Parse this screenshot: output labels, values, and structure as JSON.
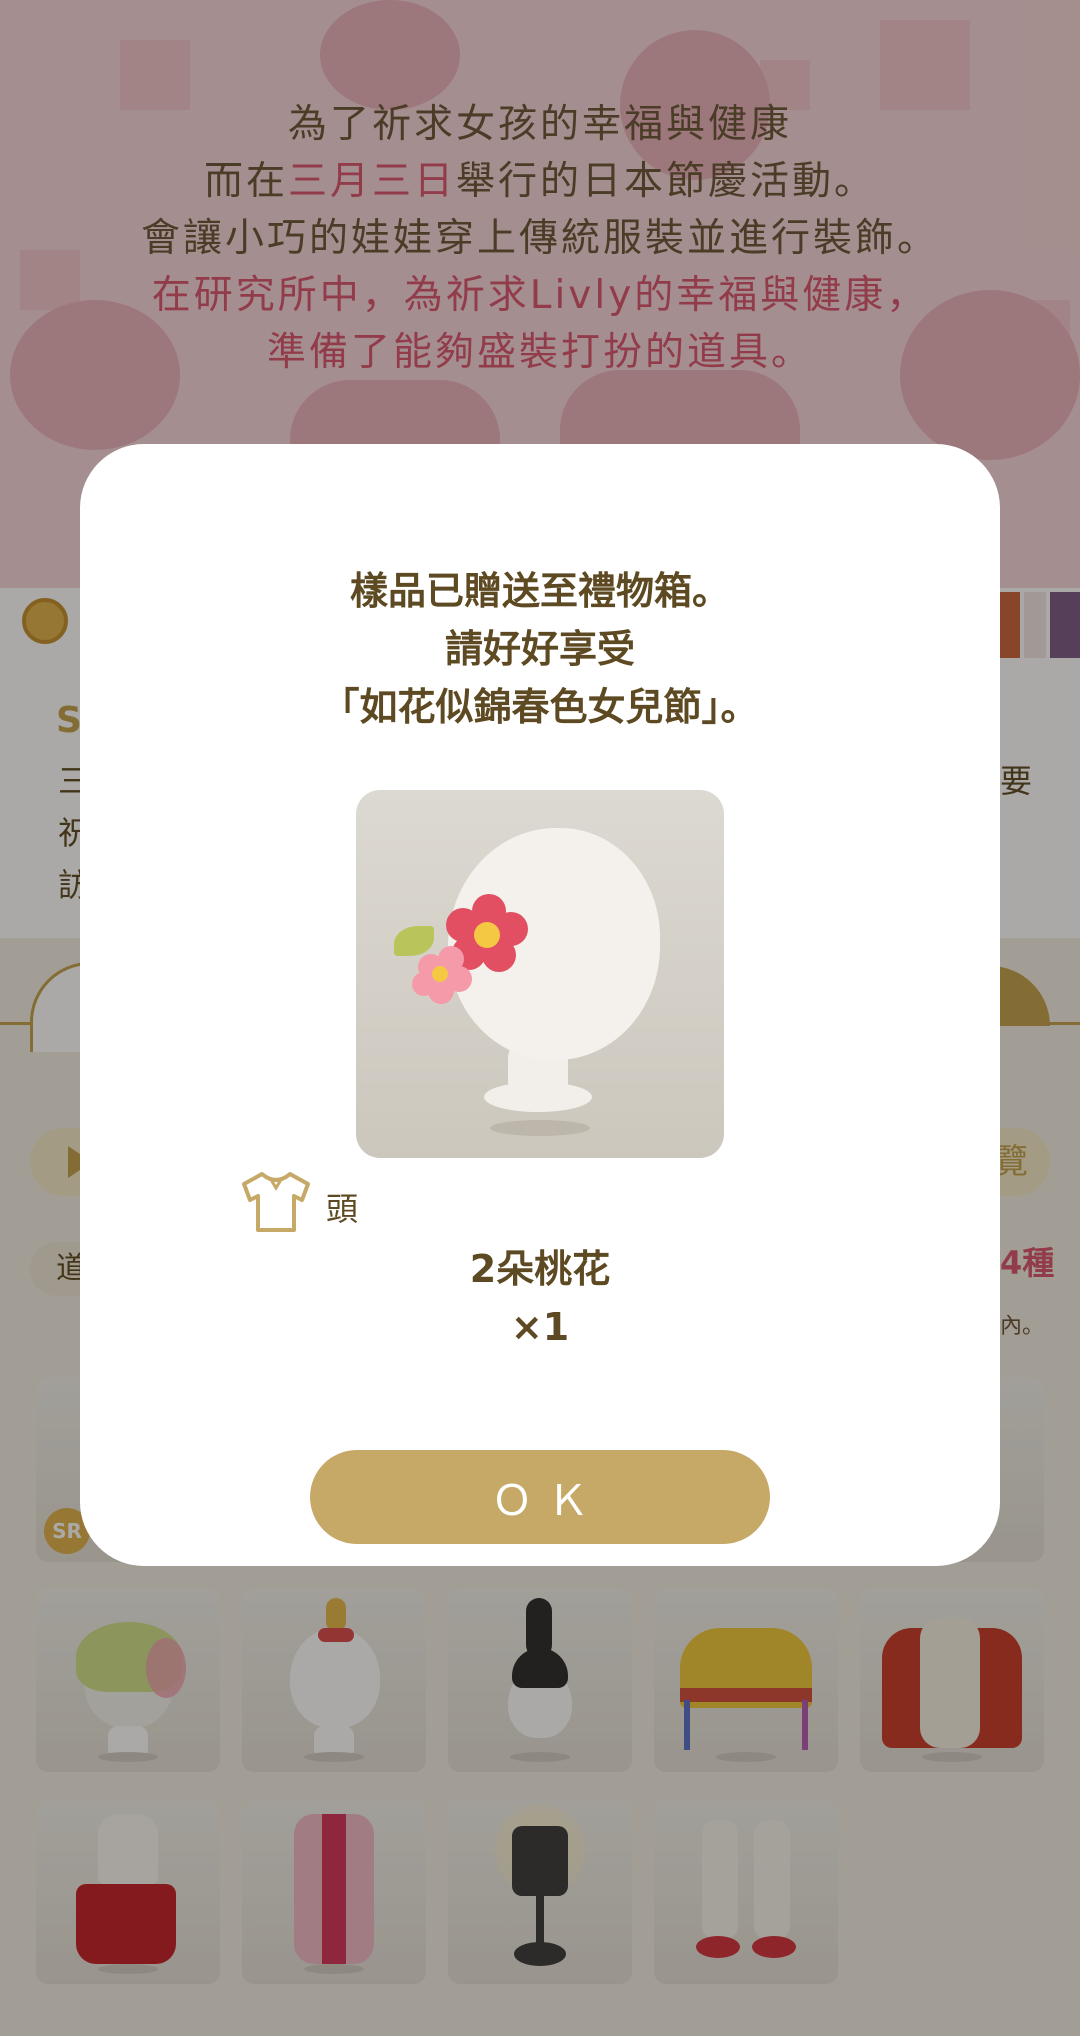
{
  "banner": {
    "lines": [
      {
        "parts": [
          {
            "text": "為了祈求女孩的幸福與健康",
            "accent": false
          }
        ]
      },
      {
        "parts": [
          {
            "text": "而在",
            "accent": false
          },
          {
            "text": "三月三日",
            "accent": true
          },
          {
            "text": "舉行的日本節慶活動。",
            "accent": false
          }
        ]
      },
      {
        "parts": [
          {
            "text": "會讓小巧的娃娃穿上傳統服裝並進行裝飾。",
            "accent": false
          }
        ]
      },
      {
        "parts": [
          {
            "text": "在研究所中，為祈求Livly的幸福與健康，",
            "accent": true
          }
        ]
      },
      {
        "parts": [
          {
            "text": "準備了能夠盛裝打扮的道具。",
            "accent": true
          }
        ]
      }
    ]
  },
  "background": {
    "desc_title": "S",
    "desc_left_glyphs": [
      "三",
      "祝",
      "訪"
    ],
    "desc_right_glyph": "要",
    "filter_right_glyph": "覽",
    "category_chip": "道",
    "right_count": "4種",
    "right_note": "內。",
    "sr_badge": "SR"
  },
  "colors": {
    "accent_gold": "#c6a867",
    "accent_pink": "#d9556f",
    "text_brown": "#5e4a22"
  },
  "modal": {
    "message_lines": [
      "樣品已贈送至禮物箱。",
      "請好好享受",
      "「如花似錦春色女兒節」。"
    ],
    "item_image_icon": "hair-ornament-icon",
    "category_icon": "shirt-icon",
    "category_label": "頭",
    "item_name": "2朵桃花",
    "item_quantity": "×1",
    "ok_label": "ＯＫ"
  }
}
